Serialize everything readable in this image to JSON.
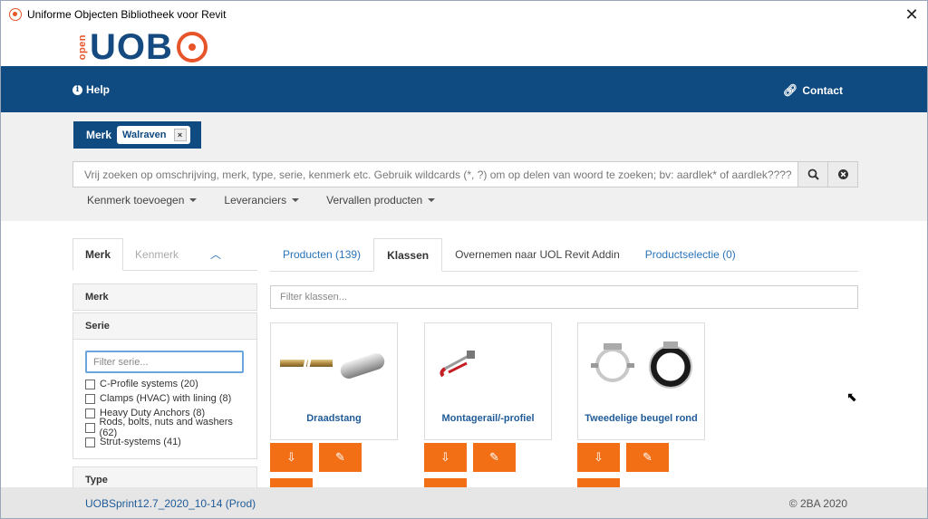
{
  "window": {
    "title": "Uniforme Objecten Bibliotheek voor Revit",
    "close_icon": "close-icon"
  },
  "logo": {
    "open": "open",
    "text": "UOB"
  },
  "nav": {
    "help": "Help",
    "contact": "Contact"
  },
  "search": {
    "brand_label": "Merk",
    "brand_chip": "Walraven",
    "brand_chip_remove": "×",
    "placeholder": "Vrij zoeken op omschrijving, merk, type, serie, kenmerk etc. Gebruik wildcards (*, ?) om op delen van woord te zoeken; bv: aardlek* of aardlek????",
    "filters": [
      "Kenmerk toevoegen",
      "Leveranciers",
      "Vervallen producten"
    ]
  },
  "sidebar": {
    "tabs": {
      "active": "Merk",
      "inactive": "Kenmerk"
    },
    "merk_header": "Merk",
    "serie_header": "Serie",
    "serie_filter_placeholder": "Filter serie...",
    "series": [
      "C-Profile systems (20)",
      "Clamps (HVAC) with lining (8)",
      "Heavy Duty Anchors (8)",
      "Rods, bolts, nuts and washers (62)",
      "Strut-systems (41)"
    ],
    "type_header": "Type"
  },
  "main": {
    "tabs": [
      "Producten (139)",
      "Klassen",
      "Overnemen naar UOL Revit Addin",
      "Productselectie (0)"
    ],
    "klassen_filter_placeholder": "Filter klassen...",
    "cards": [
      {
        "name": "Draadstang"
      },
      {
        "name": "Montagerail/-profiel"
      },
      {
        "name": "Tweedelige beugel rond"
      }
    ]
  },
  "footer": {
    "version": "UOBSprint12.7_2020_10-14 (Prod)",
    "copyright": "© 2BA 2020"
  },
  "colors": {
    "primary": "#0f4a80",
    "accent": "#f36f16",
    "logo_orange": "#e8542a"
  }
}
